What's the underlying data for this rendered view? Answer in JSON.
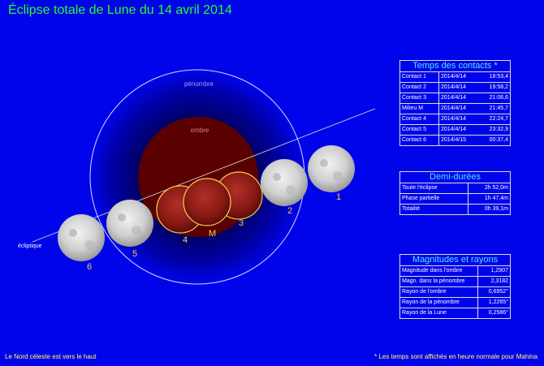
{
  "title": "Éclipse totale de Lune du 14 avril 2014",
  "labels": {
    "penumbra": "pénombre",
    "umbra": "ombre",
    "ecliptic": "écliptique"
  },
  "moons": [
    {
      "label": "1"
    },
    {
      "label": "2"
    },
    {
      "label": "3"
    },
    {
      "label": "M"
    },
    {
      "label": "4"
    },
    {
      "label": "5"
    },
    {
      "label": "6"
    }
  ],
  "contacts": {
    "title": "Temps des contacts *",
    "rows": [
      {
        "name": "Contact 1",
        "date": "2014/4/14",
        "time": "18:53,4"
      },
      {
        "name": "Contact 2",
        "date": "2014/4/14",
        "time": "19:58,2"
      },
      {
        "name": "Contact 3",
        "date": "2014/4/14",
        "time": "21:06,6"
      },
      {
        "name": "Milieu M",
        "date": "2014/4/14",
        "time": "21:45,7"
      },
      {
        "name": "Contact 4",
        "date": "2014/4/14",
        "time": "22:24,7"
      },
      {
        "name": "Contact 5",
        "date": "2014/4/14",
        "time": "23:32,9"
      },
      {
        "name": "Contact 6",
        "date": "2014/4/15",
        "time": "00:37,4"
      }
    ]
  },
  "durations": {
    "title": "Demi-durées",
    "rows": [
      {
        "name": "Toute l'éclipse",
        "value": "2h 52,0m"
      },
      {
        "name": "Phase partielle",
        "value": "1h 47,4m"
      },
      {
        "name": "Totalité",
        "value": "0h 39,1m"
      }
    ]
  },
  "magnitudes": {
    "title": "Magnitudes et rayons",
    "rows": [
      {
        "name": "Magnitude dans l'ombre",
        "value": "1,2907"
      },
      {
        "name": "Magn. dans la pénombre",
        "value": "2,3182"
      },
      {
        "name": "Rayon de l'ombre",
        "value": "0,6952°"
      },
      {
        "name": "Rayon de la pénombre",
        "value": "1,2265°"
      },
      {
        "name": "Rayon de la Lune",
        "value": "0,2586°"
      }
    ]
  },
  "footer": {
    "left": "Le Nord céleste est vers le haut",
    "right": "* Les temps sont affichés en heure normale pour Mahina"
  },
  "colors": {
    "background": "#0004ea",
    "title": "#2ef82e",
    "panel_title": "#55e6ff",
    "label": "#ffcc55",
    "footer": "#ffff66",
    "umbra": "#5a0000",
    "penumbra_outline": "#d8d8ff"
  }
}
